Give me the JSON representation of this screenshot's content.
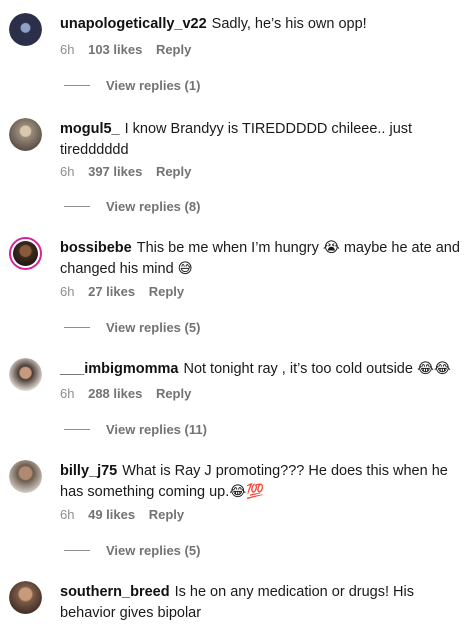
{
  "comments": [
    {
      "username": "unapologetically_v22",
      "text": "Sadly, he’s his own opp!",
      "time": "6h",
      "likes": "103 likes",
      "reply": "Reply",
      "view_replies": "View replies (1)",
      "avatar_color": "#2b2f4a"
    },
    {
      "username": "mogul5_",
      "text": "I know Brandyy is TIREDDDDD chileee.. just tiredddddd",
      "time": "6h",
      "likes": "397 likes",
      "reply": "Reply",
      "view_replies": "View replies (8)",
      "avatar_color": "#9a8c7a"
    },
    {
      "username": "bossibebe",
      "text": "This be me when I’m hungry 😭 maybe he ate and changed his mind 😅",
      "time": "6h",
      "likes": "27 likes",
      "reply": "Reply",
      "view_replies": "View replies (5)",
      "avatar_color": "#3a2a20"
    },
    {
      "username": "___imbigmomma",
      "text": "Not tonight ray , it’s too cold outside 😂😂",
      "time": "6h",
      "likes": "288 likes",
      "reply": "Reply",
      "view_replies": "View replies (11)",
      "avatar_color": "#4a3b33"
    },
    {
      "username": "billy_j75",
      "text": "What is Ray J promoting??? He does this when he has something coming up.😂💯",
      "time": "6h",
      "likes": "49 likes",
      "reply": "Reply",
      "view_replies": "View replies (5)",
      "avatar_color": "#6b5a4c"
    },
    {
      "username": "southern_breed",
      "text": "Is he on any medication or drugs! His behavior gives bipolar",
      "avatar_color": "#7a5a48"
    }
  ]
}
